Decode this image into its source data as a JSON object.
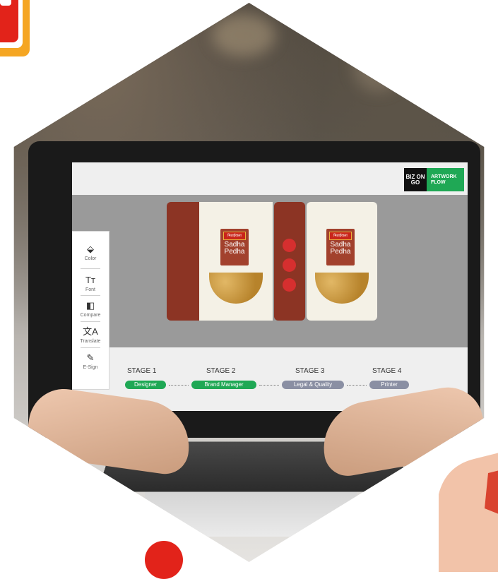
{
  "brand": {
    "logo_text": "BIZ ON GO",
    "tag": "ARTWORK FLOW"
  },
  "product": {
    "brand_label": "मिठाईवाला",
    "name_line1": "Sadha",
    "name_line2": "Pedha"
  },
  "toolbar": [
    {
      "icon": "color-fill-icon",
      "glyph": "⬙",
      "label": "Color"
    },
    {
      "icon": "font-icon",
      "glyph": "Tт",
      "label": "Font"
    },
    {
      "icon": "compare-icon",
      "glyph": "◧",
      "label": "Compare"
    },
    {
      "icon": "translate-icon",
      "glyph": "文A",
      "label": "Translate"
    },
    {
      "icon": "esign-icon",
      "glyph": "✎",
      "label": "E-Sign"
    }
  ],
  "stages": [
    {
      "title": "STAGE 1",
      "label": "Designer",
      "color": "#1fa855"
    },
    {
      "title": "STAGE 2",
      "label": "Brand Manager",
      "color": "#1fa855"
    },
    {
      "title": "STAGE 3",
      "label": "Legal & Quality",
      "color": "#8a8fa3"
    },
    {
      "title": "STAGE 4",
      "label": "Printer",
      "color": "#8a8fa3"
    }
  ],
  "colors": {
    "accent_green": "#1fa855",
    "package_brown": "#8c3424",
    "decor_red": "#e2231a",
    "decor_orange": "#f5a623"
  }
}
